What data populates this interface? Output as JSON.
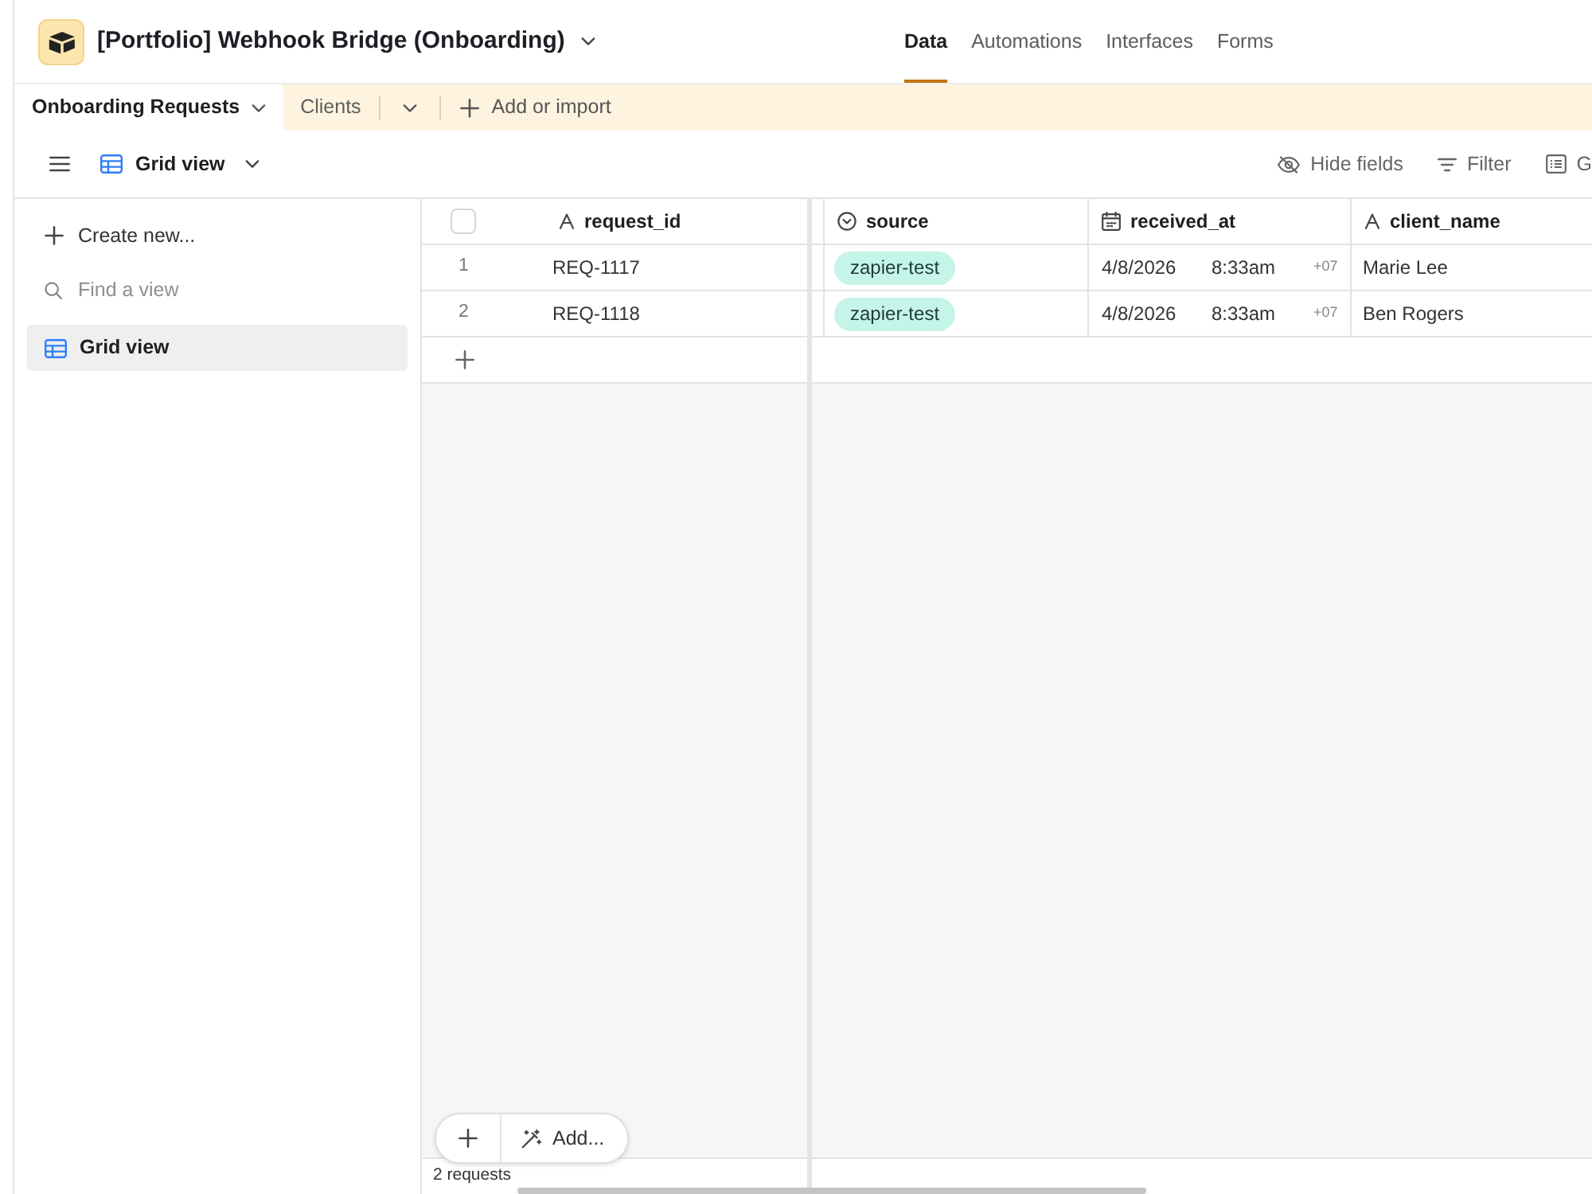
{
  "base": {
    "title": "[Portfolio] Webhook Bridge (Onboarding)"
  },
  "nav_tabs": [
    {
      "label": "Data",
      "selected": true
    },
    {
      "label": "Automations",
      "selected": false
    },
    {
      "label": "Interfaces",
      "selected": false
    },
    {
      "label": "Forms",
      "selected": false
    }
  ],
  "table_tabs": [
    {
      "label": "Onboarding Requests",
      "selected": true
    },
    {
      "label": "Clients",
      "selected": false
    }
  ],
  "add_table": {
    "label": "Add or import"
  },
  "view_bar": {
    "view_name": "Grid view",
    "actions": [
      {
        "kind": "hide",
        "label": "Hide fields"
      },
      {
        "kind": "filter",
        "label": "Filter"
      },
      {
        "kind": "group",
        "label": "G"
      }
    ]
  },
  "sidebar": {
    "create_label": "Create new...",
    "search": {
      "placeholder": "Find a view"
    },
    "views": [
      {
        "label": "Grid view",
        "selected": true
      }
    ]
  },
  "table": {
    "select_all": {
      "checked": false
    },
    "columns": [
      {
        "name": "request_id",
        "kind": "text"
      },
      {
        "name": "source",
        "kind": "select"
      },
      {
        "name": "received_at",
        "kind": "date"
      },
      {
        "name": "client_name",
        "kind": "text"
      }
    ],
    "rows": [
      {
        "number": "1",
        "cells": [
          {
            "text": "REQ-1117"
          },
          {
            "text": "zapier-test"
          },
          {
            "date": "4/8/2026",
            "time": "8:33am",
            "timezone": "+07"
          },
          {
            "text": "Marie Lee"
          }
        ]
      },
      {
        "number": "2",
        "cells": [
          {
            "text": "REQ-1118"
          },
          {
            "text": "zapier-test"
          },
          {
            "date": "4/8/2026",
            "time": "8:33am",
            "timezone": "+07"
          },
          {
            "text": "Ben Rogers"
          }
        ]
      }
    ]
  },
  "add_bar": {
    "label": "Add..."
  },
  "status_bar": {
    "count": "2 requests"
  }
}
